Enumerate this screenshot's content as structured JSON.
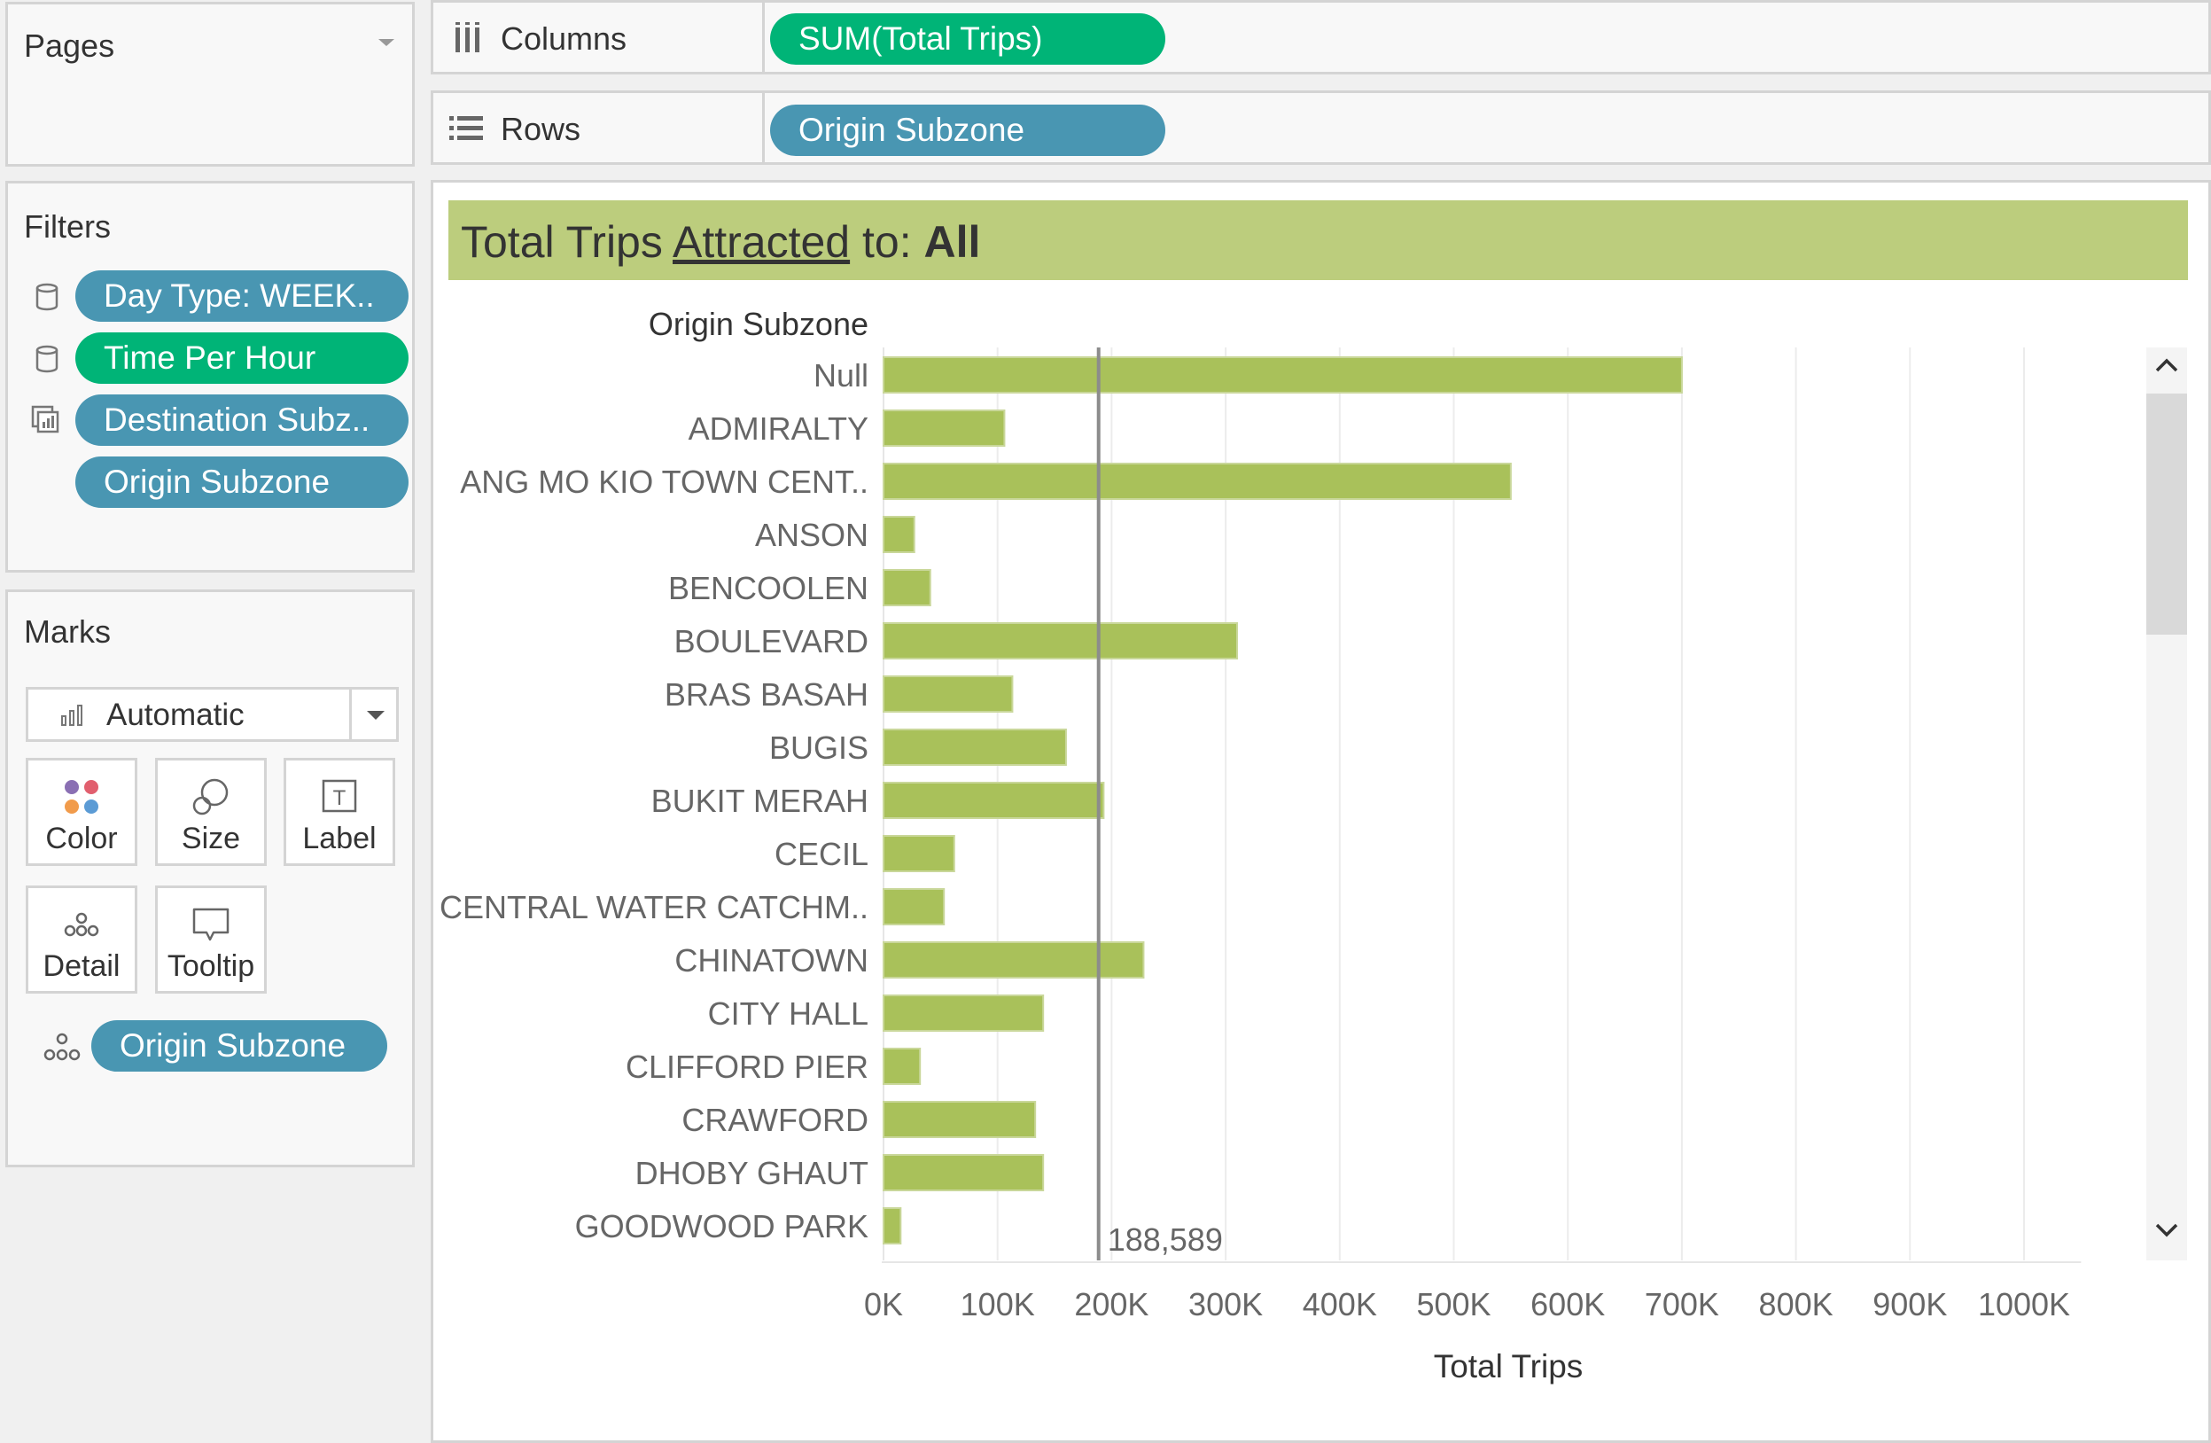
{
  "pages": {
    "title": "Pages"
  },
  "filters": {
    "title": "Filters",
    "items": [
      {
        "label": "Day Type: WEEK..",
        "color": "#4996b2",
        "icon": "database-icon"
      },
      {
        "label": "Time Per Hour",
        "color": "#00b477",
        "icon": "database-icon"
      },
      {
        "label": "Destination Subz..",
        "color": "#4996b2",
        "icon": "set-icon"
      },
      {
        "label": "Origin Subzone",
        "color": "#4996b2",
        "icon": ""
      }
    ]
  },
  "marks": {
    "title": "Marks",
    "type_value": "Automatic",
    "cards": [
      "Color",
      "Size",
      "Label",
      "Detail",
      "Tooltip"
    ],
    "detail_pill": "Origin Subzone"
  },
  "shelves": {
    "columns_label": "Columns",
    "columns_pill": "SUM(Total Trips)",
    "rows_label": "Rows",
    "rows_pill": "Origin Subzone"
  },
  "view": {
    "title_prefix": "Total Trips ",
    "title_link": "Attracted",
    "title_mid": " to: ",
    "title_bold": "All"
  },
  "chart_data": {
    "type": "bar",
    "orientation": "horizontal",
    "row_header": "Origin Subzone",
    "xlabel": "Total Trips",
    "categories": [
      "Null",
      "ADMIRALTY",
      "ANG MO KIO TOWN CENT..",
      "ANSON",
      "BENCOOLEN",
      "BOULEVARD",
      "BRAS BASAH",
      "BUGIS",
      "BUKIT MERAH",
      "CECIL",
      "CENTRAL WATER CATCHM..",
      "CHINATOWN",
      "CITY HALL",
      "CLIFFORD PIER",
      "CRAWFORD",
      "DHOBY GHAUT",
      "GOODWOOD PARK"
    ],
    "values": [
      700000,
      106000,
      550000,
      27000,
      41000,
      310000,
      113000,
      160000,
      193000,
      62000,
      53000,
      228000,
      140000,
      32000,
      133000,
      140000,
      15000
    ],
    "xlim": [
      0,
      1050000
    ],
    "xticks": [
      0,
      100000,
      200000,
      300000,
      400000,
      500000,
      600000,
      700000,
      800000,
      900000,
      1000000
    ],
    "xtick_labels": [
      "0K",
      "100K",
      "200K",
      "300K",
      "400K",
      "500K",
      "600K",
      "700K",
      "800K",
      "900K",
      "1000K"
    ],
    "reference_line": {
      "value": 188589,
      "label": "188,589"
    },
    "bar_color": "#a9c15a",
    "grid": true
  }
}
